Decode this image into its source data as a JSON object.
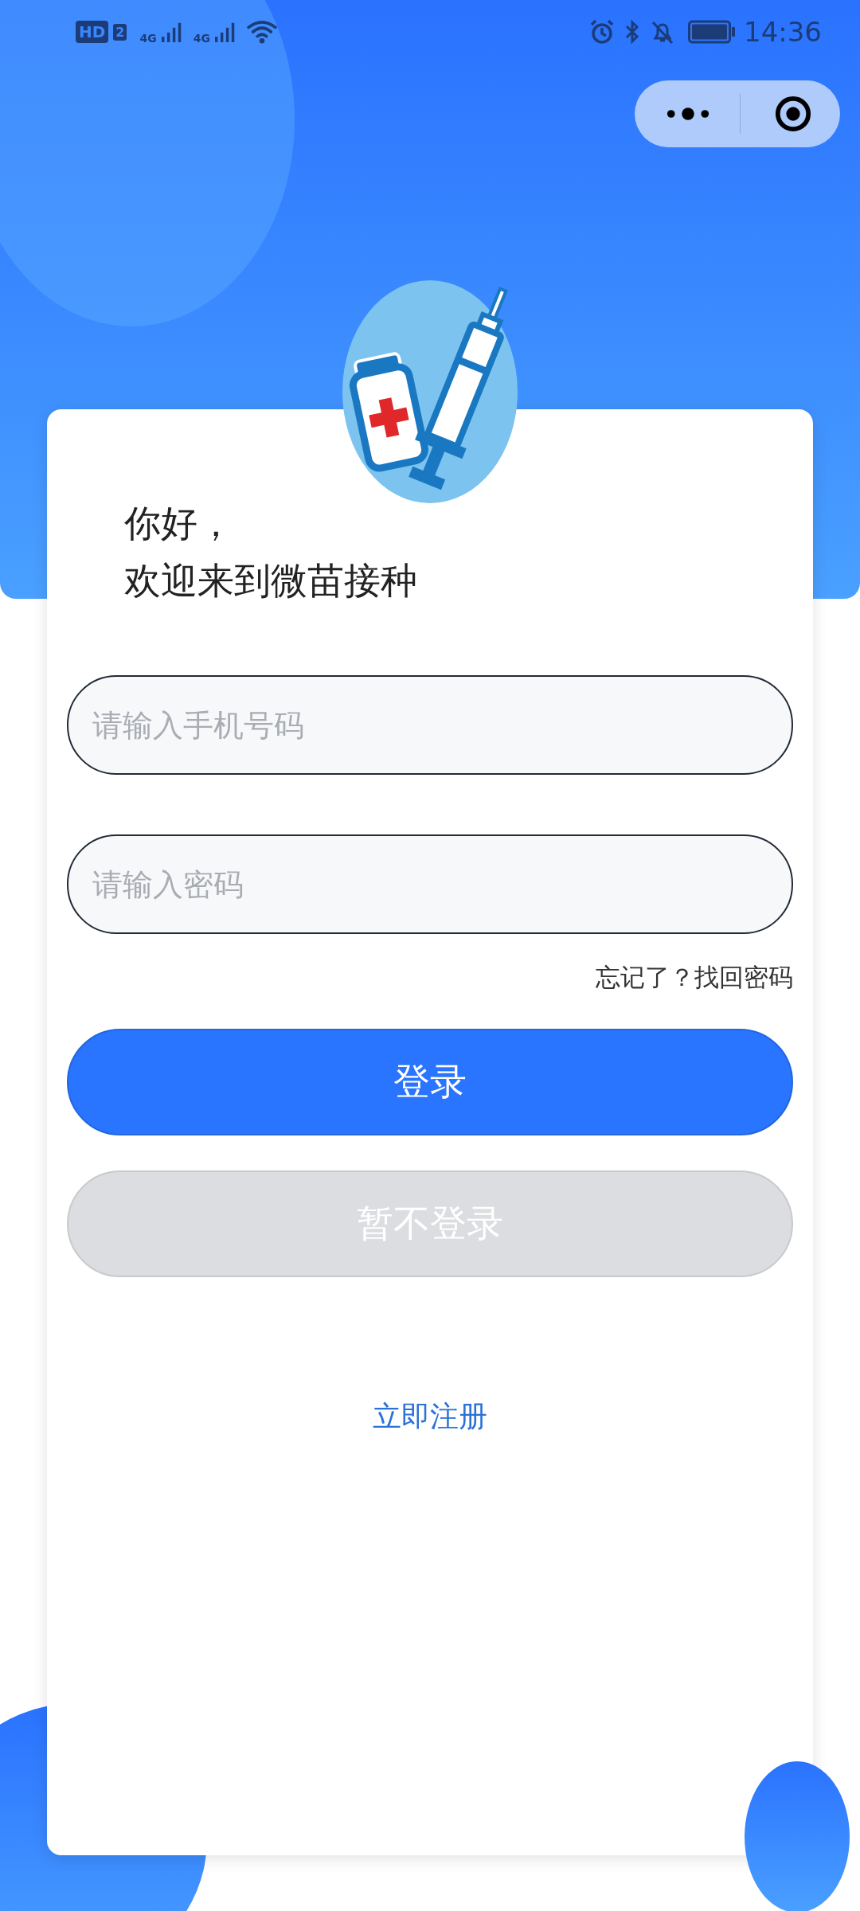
{
  "status_bar": {
    "hd_label": "HD",
    "sim_label": "2",
    "network_labels": [
      "4G",
      "4G"
    ],
    "time": "14:36"
  },
  "greeting": {
    "line_1": "你好，",
    "line_2": "欢迎来到微苗接种"
  },
  "phone_field": {
    "placeholder": "请输入手机号码"
  },
  "password_field": {
    "placeholder": "请输入密码"
  },
  "forgot_link": "忘记了？找回密码",
  "login_button": "登录",
  "skip_button": {
    "label": "暂不登录",
    "disabled": true
  },
  "register_link": "立即注册"
}
